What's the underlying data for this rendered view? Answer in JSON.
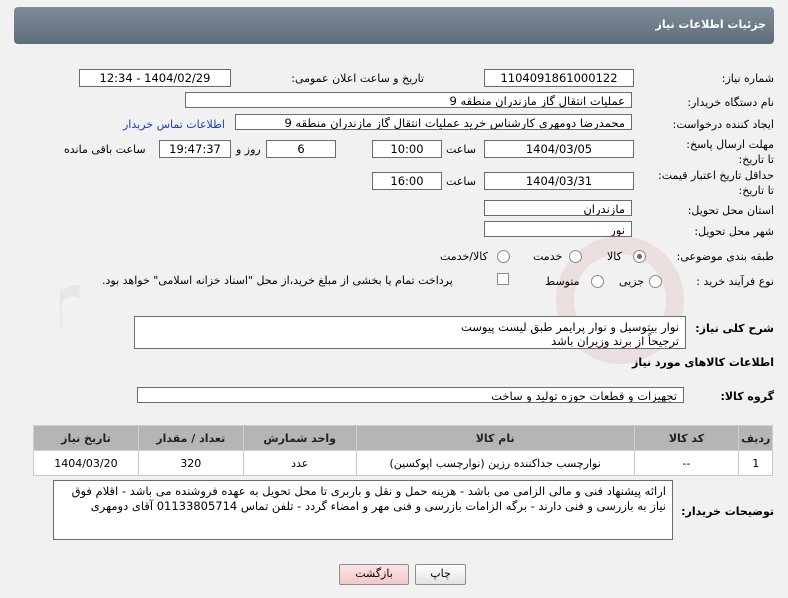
{
  "header": {
    "title": "جزئیات اطلاعات نیاز"
  },
  "fields": {
    "need_number_label": "شماره نیاز:",
    "need_number": "1104091861000122",
    "announce_label": "تاریخ و ساعت اعلان عمومی:",
    "announce_value": "1404/02/29 - 12:34",
    "buyer_org_label": "نام دستگاه خریدار:",
    "buyer_org": "عملیات انتقال گاز مازندران منطقه 9",
    "creator_label": "ایجاد کننده درخواست:",
    "creator": "محمدرضا دومهری کارشناس خرید عملیات انتقال گاز مازندران منطقه 9",
    "contact_link": "اطلاعات تماس خریدار",
    "reply_deadline_label": "مهلت ارسال پاسخ: تا تاریخ:",
    "reply_date": "1404/03/05",
    "time_label": "ساعت",
    "reply_time": "10:00",
    "days_value": "6",
    "days_label": "روز و",
    "remaining_time": "19:47:37",
    "remaining_label": "ساعت باقی مانده",
    "price_validity_label": "حداقل تاریخ اعتبار قیمت: تا تاریخ:",
    "price_date": "1404/03/31",
    "price_time": "16:00",
    "province_label": "استان محل تحویل:",
    "province": "مازندران",
    "city_label": "شهر محل تحویل:",
    "city": "نور",
    "category_label": "طبقه بندی موضوعی:",
    "category_options": [
      "کالا",
      "خدمت",
      "کالا/خدمت"
    ],
    "process_label": "نوع فرآیند خرید :",
    "process_options": [
      "جزیی",
      "متوسط"
    ],
    "payment_note": "پرداخت تمام یا بخشی از مبلغ خرید،از محل \"اسناد خزانه اسلامی\" خواهد بود.",
    "description_label": "شرح کلی نیاز:",
    "description_line1": "نوار بیتوسیل و نوار پرایمر طبق لیست پیوست",
    "description_line2": "ترجیحاً از برند وزیران باشد",
    "goods_info_title": "اطلاعات کالاهای مورد نیاز",
    "goods_group_label": "گروه کالا:",
    "goods_group": "تجهیزات و قطعات حوزه تولید و ساخت",
    "buyer_notes_label": "توضیحات خریدار:",
    "buyer_notes": "ارائه پیشنهاد فنی و مالی الزامی می باشد - هزینه حمل و نقل و باربری تا محل تحویل به عهده فروشنده می باشد - اقلام فوق نیاز به بازرسی و فنی دارند - برگه الزامات بازرسی و فنی مهر و امضاء گردد - تلفن تماس 01133805714 آقای دومهری"
  },
  "table": {
    "headers": [
      "ردیف",
      "کد کالا",
      "نام کالا",
      "واحد شمارش",
      "تعداد / مقدار",
      "تاریخ نیاز"
    ],
    "rows": [
      [
        "1",
        "--",
        "نوارچسب جداکننده رزین (نوارچسب اپوکسین)",
        "عدد",
        "320",
        "1404/03/20"
      ]
    ]
  },
  "buttons": {
    "print": "چاپ",
    "back": "بازگشت"
  },
  "colors": {
    "header_bg": "#6f7d8a",
    "link": "#1a3fb8",
    "back_button": "#f3c9c9"
  }
}
